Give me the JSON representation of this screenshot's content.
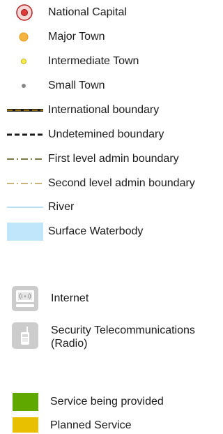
{
  "legend": {
    "settlements": [
      {
        "label": "National Capital",
        "color": "#e03b3b",
        "ring": "#b22222"
      },
      {
        "label": "Major Town",
        "color": "#f5b342"
      },
      {
        "label": "Intermediate Town",
        "color": "#f5ea4a"
      },
      {
        "label": "Small Town",
        "color": "#888888"
      }
    ],
    "boundaries": [
      {
        "label": "International boundary",
        "color": "#1a1a1a",
        "accent": "#b8860b"
      },
      {
        "label": "Undetemined boundary",
        "color": "#1a1a1a"
      },
      {
        "label": "First level admin boundary",
        "color": "#7a7a4a"
      },
      {
        "label": "Second level admin boundary",
        "color": "#c8b478"
      }
    ],
    "water": [
      {
        "label": "River",
        "color": "#9fd8f2"
      },
      {
        "label": "Surface Waterbody",
        "color": "#bfe6fa"
      }
    ],
    "services": [
      {
        "label": "Internet",
        "icon": "internet-icon",
        "color": "#cccccc"
      },
      {
        "label": "Security Telecommunications (Radio)",
        "icon": "radio-icon",
        "color": "#cccccc"
      }
    ],
    "status": [
      {
        "label": "Service being provided",
        "color": "#5fa800"
      },
      {
        "label": "Planned Service",
        "color": "#e8c000"
      }
    ]
  }
}
